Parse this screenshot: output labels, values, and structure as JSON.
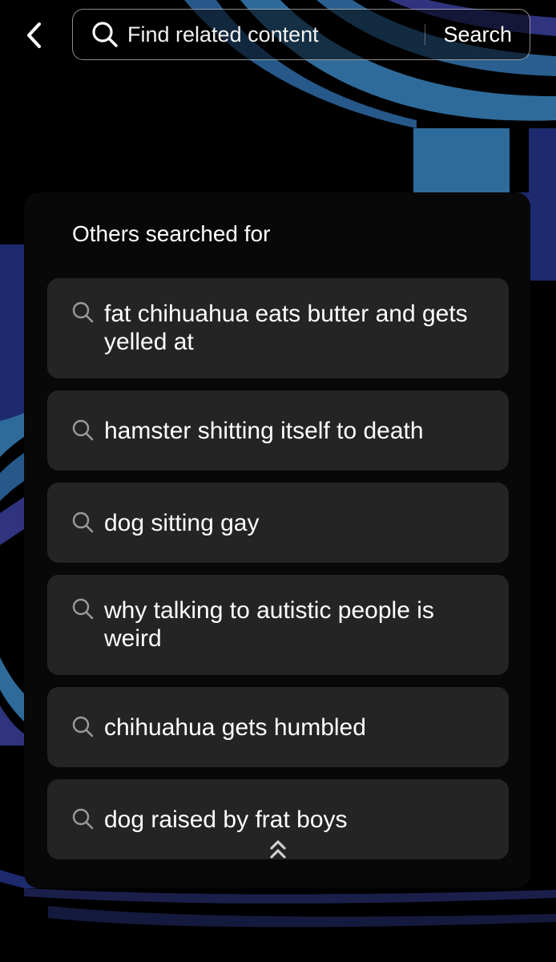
{
  "search": {
    "placeholder": "Find related content",
    "submit_label": "Search"
  },
  "section_title": "Others searched for",
  "suggestions": [
    {
      "text": "fat chihuahua eats butter and gets yelled at"
    },
    {
      "text": "hamster shitting itself to death"
    },
    {
      "text": "dog sitting gay"
    },
    {
      "text": "why talking to autistic people is weird"
    },
    {
      "text": "chihuahua gets humbled"
    },
    {
      "text": "dog raised by frat boys"
    }
  ],
  "icons": {
    "back": "chevron-left-icon",
    "search": "search-icon",
    "expand": "double-chevron-up-icon"
  },
  "colors": {
    "background": "#000000",
    "panel": "#080808",
    "suggestion_bg": "#242424",
    "text": "#ffffff",
    "art_blue": "#2f6b9a",
    "art_navy": "#1d2a6e",
    "art_purple": "#3a2d7a"
  }
}
